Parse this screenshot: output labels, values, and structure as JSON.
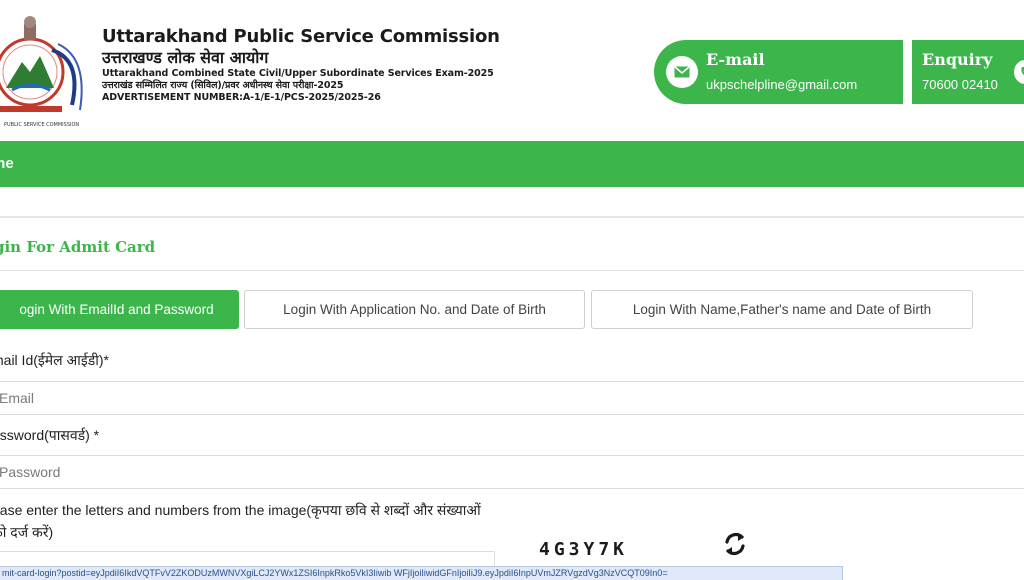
{
  "header": {
    "title": "Uttarakhand Public Service Commission",
    "title_hindi": "उत्तराखण्ड लोक सेवा आयोग",
    "exam_line": "Uttarakhand Combined State Civil/Upper Subordinate Services Exam-2025",
    "exam_line_hindi": "उत्तराखंड सम्मिलित राज्य (सिविल)/प्रवर अधीनस्थ सेवा परीक्षा-2025",
    "advertisement": "ADVERTISEMENT NUMBER:A-1/E-1/PCS-2025/2025-26",
    "logo_icon": "ukpsc-emblem-logo",
    "logo_caption": "PUBLIC SERVICE COMMISSION"
  },
  "contact": {
    "email_label": "E-mail",
    "email_value": "ukpschelpline@gmail.com",
    "email_icon": "envelope-icon",
    "enquiry_label": "Enquiry",
    "enquiry_value": "70600 02410",
    "enquiry_icon": "phone-icon"
  },
  "nav": {
    "home_label": "me"
  },
  "section": {
    "title": "gin For Admit Card"
  },
  "tabs": [
    {
      "label": "ogin With EmailId and Password",
      "active": true
    },
    {
      "label": "Login With Application No. and Date of Birth",
      "active": false
    },
    {
      "label": "Login With Name,Father's name and Date of Birth",
      "active": false
    }
  ],
  "form": {
    "email_label": "mail Id(ईमेल आईडी)*",
    "email_placeholder": "Email",
    "password_label": "assword(पासवर्ड) *",
    "password_placeholder": "Password",
    "captcha_label": "ease enter the letters and numbers from the image(कृपया छवि से शब्दों और संख्याओं को दर्ज करें)",
    "captcha_code": "4G3Y7K",
    "refresh_icon": "refresh-icon"
  },
  "statusbar": {
    "url": "mit-card-login?postid=eyJpdiI6IkdVQTFvV2ZKODUzMWNVXgiLCJ2YWx1ZSI6InpkRko5VkI3Iiwib WFjIjoiIiwidGFnIjoiIiJ9.eyJpdiI6InpUVmJZRVgzdVg3NzVCQT09In0="
  },
  "colors": {
    "brand_green": "#3cb54b",
    "text_dark": "#1b1b1b"
  }
}
